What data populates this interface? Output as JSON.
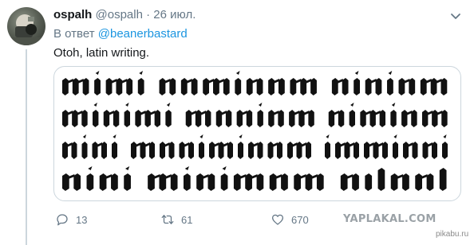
{
  "tweet": {
    "display_name": "ospalh",
    "handle": "@ospalh",
    "separator": "·",
    "date": "26 июл.",
    "reply_prefix": "В ответ",
    "reply_handle": "@beanerbastard",
    "text": "Otoh, latin writing.",
    "media": {
      "blackletter_lines": [
        "mimi numinum niuium",
        "minimi munium nimium",
        "uini muniminum imminui",
        "uiui minimum uolunt"
      ]
    }
  },
  "actions": {
    "reply_count": "13",
    "retweet_count": "61",
    "like_count": "670"
  },
  "watermark": "YAPLAKAL.COM",
  "site_tag": "pikabu.ru",
  "colors": {
    "accent": "#1b95e0",
    "secondary_text": "#657786",
    "primary_text": "#14171a"
  }
}
